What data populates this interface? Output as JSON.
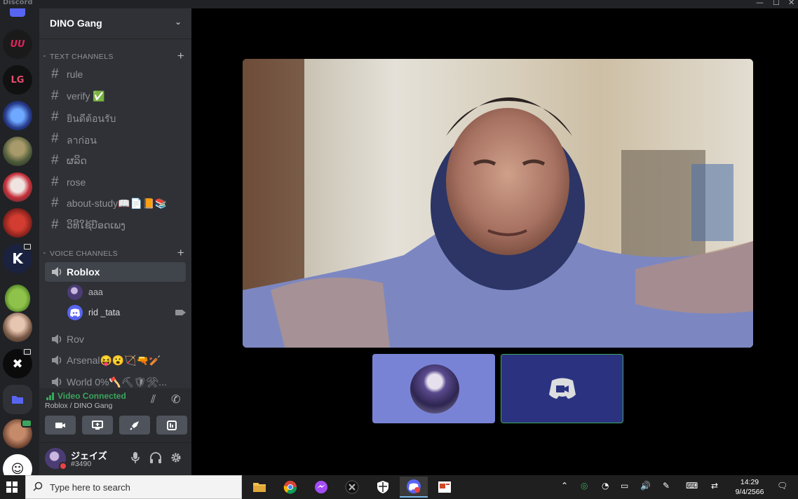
{
  "window": {
    "app_name": "Discord"
  },
  "server": {
    "name": "DINO Gang"
  },
  "text_category": "TEXT CHANNELS",
  "text_channels": [
    "rule",
    "verify ✅",
    "ยินดีต้อนรับ",
    "ลาก่อน",
    "ຜລິດ",
    "rose",
    "about-study📖📄📙📚",
    "ວິທີໃຊ້ບ໊ອດເພງ"
  ],
  "voice_category": "VOICE CHANNELS",
  "voice_channels": [
    {
      "name": "Roblox",
      "active": true
    },
    {
      "name": "Rov"
    },
    {
      "name": "Arsenal😝😮🏹🔫🏏"
    },
    {
      "name": "World 0%🪓⛏🛡⚒..."
    }
  ],
  "voice_users": [
    {
      "name": "aaa"
    },
    {
      "name": "rid _tata",
      "camera": true
    }
  ],
  "connection": {
    "status": "Video Connected",
    "location": "Roblox / DINO Gang"
  },
  "user": {
    "name": "ジェイズ",
    "tag": "#3490"
  },
  "taskbar": {
    "search_placeholder": "Type here to search",
    "time": "14:29",
    "date": "9/4/2566"
  },
  "colors": {
    "accent": "#5865f2",
    "connected_green": "#3ba55d",
    "tile_purple": "#7983d6",
    "tile_navy": "#2b3381"
  }
}
